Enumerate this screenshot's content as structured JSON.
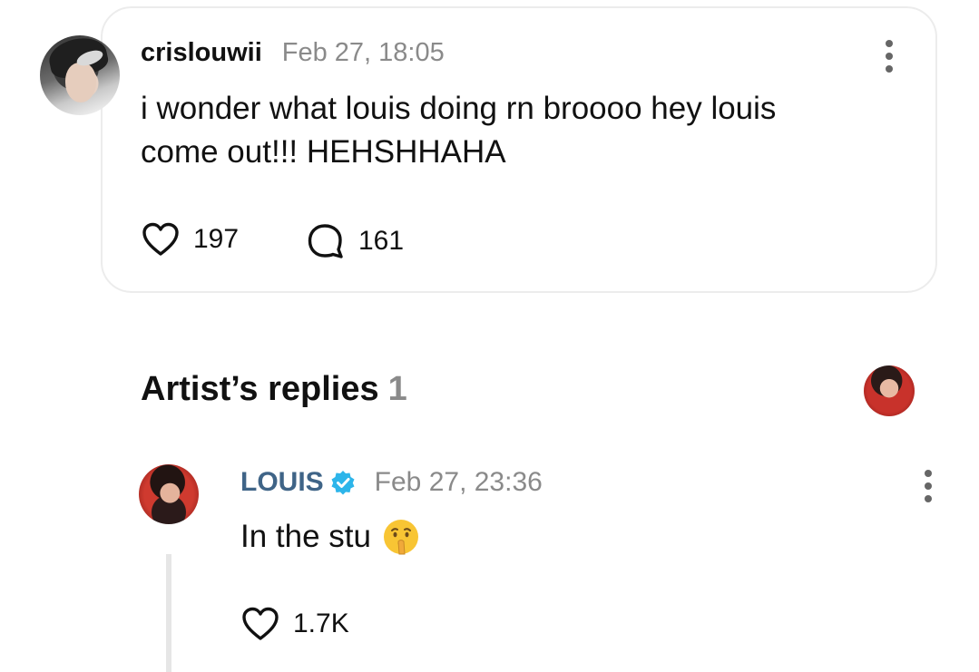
{
  "post": {
    "username": "crislouwii",
    "timestamp": "Feb 27, 18:05",
    "text": "i wonder what louis doing rn broooo hey louis\ncome out!!! HEHSHHAHA",
    "likes": "197",
    "comments": "161"
  },
  "artist_replies": {
    "title": "Artist’s replies",
    "count": "1"
  },
  "reply": {
    "username": "LOUIS",
    "timestamp": "Feb 27, 23:36",
    "text": "In the stu",
    "likes": "1.7K",
    "verified_color": "#2db5ea"
  },
  "icons": {
    "like": "heart-icon",
    "comment": "speech-bubble-icon",
    "menu": "more-vertical-icon",
    "verified": "verified-badge-icon",
    "emoji": "shushing-face-emoji"
  }
}
